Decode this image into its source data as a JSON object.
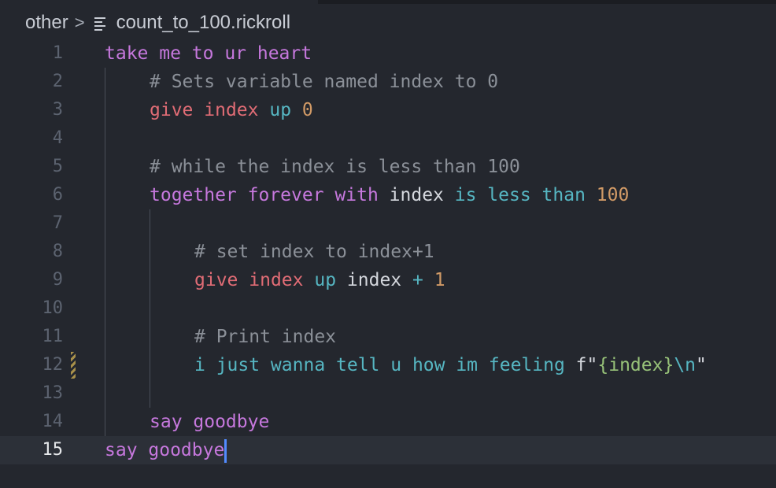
{
  "breadcrumb": {
    "folder": "other",
    "separator": ">",
    "file": "count_to_100.rickroll",
    "file_icon": "file-lines-icon"
  },
  "lines": [
    {
      "number": "1",
      "tokens": [
        {
          "text": "take me to ur heart",
          "kind": "keyword"
        }
      ]
    },
    {
      "number": "2",
      "tokens": [
        {
          "text": "# Sets variable named index to 0",
          "kind": "comment"
        }
      ]
    },
    {
      "number": "3",
      "tokens": [
        {
          "text": "give",
          "kind": "red"
        },
        {
          "text": " "
        },
        {
          "text": "index",
          "kind": "red"
        },
        {
          "text": " "
        },
        {
          "text": "up",
          "kind": "cyan"
        },
        {
          "text": " "
        },
        {
          "text": "0",
          "kind": "number"
        }
      ]
    },
    {
      "number": "4",
      "tokens": []
    },
    {
      "number": "5",
      "tokens": [
        {
          "text": "# while the index is less than 100",
          "kind": "comment"
        }
      ]
    },
    {
      "number": "6",
      "tokens": [
        {
          "text": "together forever with",
          "kind": "keyword"
        },
        {
          "text": " "
        },
        {
          "text": "index",
          "kind": "plain"
        },
        {
          "text": " "
        },
        {
          "text": "is less than",
          "kind": "cyan"
        },
        {
          "text": " "
        },
        {
          "text": "100",
          "kind": "number"
        }
      ]
    },
    {
      "number": "7",
      "tokens": []
    },
    {
      "number": "8",
      "tokens": [
        {
          "text": "# set index to index+1",
          "kind": "comment"
        }
      ]
    },
    {
      "number": "9",
      "tokens": [
        {
          "text": "give",
          "kind": "red"
        },
        {
          "text": " "
        },
        {
          "text": "index",
          "kind": "red"
        },
        {
          "text": " "
        },
        {
          "text": "up",
          "kind": "cyan"
        },
        {
          "text": " "
        },
        {
          "text": "index",
          "kind": "plain"
        },
        {
          "text": " "
        },
        {
          "text": "+",
          "kind": "cyan"
        },
        {
          "text": " "
        },
        {
          "text": "1",
          "kind": "number"
        }
      ]
    },
    {
      "number": "10",
      "tokens": []
    },
    {
      "number": "11",
      "tokens": [
        {
          "text": "# Print index",
          "kind": "comment"
        }
      ]
    },
    {
      "number": "12",
      "tokens": [
        {
          "text": "i just wanna tell u how im feeling",
          "kind": "cyan"
        },
        {
          "text": " "
        },
        {
          "text": "f",
          "kind": "plain"
        },
        {
          "text": "\"",
          "kind": "plain"
        },
        {
          "text": "{index}",
          "kind": "string"
        },
        {
          "text": "\\n",
          "kind": "cyan"
        },
        {
          "text": "\"",
          "kind": "plain"
        }
      ]
    },
    {
      "number": "13",
      "tokens": []
    },
    {
      "number": "14",
      "tokens": [
        {
          "text": "say goodbye",
          "kind": "keyword"
        }
      ]
    },
    {
      "number": "15",
      "tokens": [
        {
          "text": "say goodbye",
          "kind": "keyword"
        }
      ]
    }
  ],
  "colors": {
    "background": "#24272e",
    "keyword": "#c678dd",
    "red": "#e06c75",
    "cyan": "#56b6c2",
    "number": "#d19a66",
    "comment": "#8b9098",
    "string": "#98c379",
    "cursor": "#528bff"
  }
}
